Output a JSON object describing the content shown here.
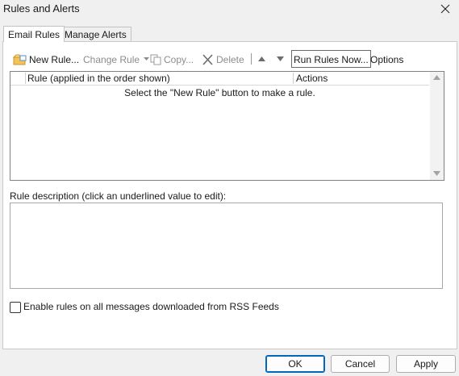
{
  "window": {
    "title": "Rules and Alerts"
  },
  "tabs": [
    {
      "label": "Email Rules",
      "active": true
    },
    {
      "label": "Manage Alerts",
      "active": false
    }
  ],
  "toolbar": {
    "new_rule": "New Rule...",
    "change_rule": "Change Rule",
    "copy": "Copy...",
    "delete": "Delete",
    "run_rules_now": "Run Rules Now...",
    "options": "Options"
  },
  "rules_list": {
    "columns": [
      "Rule (applied in the order shown)",
      "Actions"
    ],
    "empty_message": "Select the \"New Rule\" button to make a rule."
  },
  "description": {
    "label": "Rule description (click an underlined value to edit):"
  },
  "rss": {
    "label": "Enable rules on all messages downloaded from RSS Feeds",
    "checked": false
  },
  "buttons": {
    "ok": "OK",
    "cancel": "Cancel",
    "apply": "Apply"
  },
  "colors": {
    "accent": "#0067c0",
    "disabled_text": "#8c8c8c",
    "panel_bg": "#ffffff",
    "window_bg": "#f0f0f0"
  }
}
